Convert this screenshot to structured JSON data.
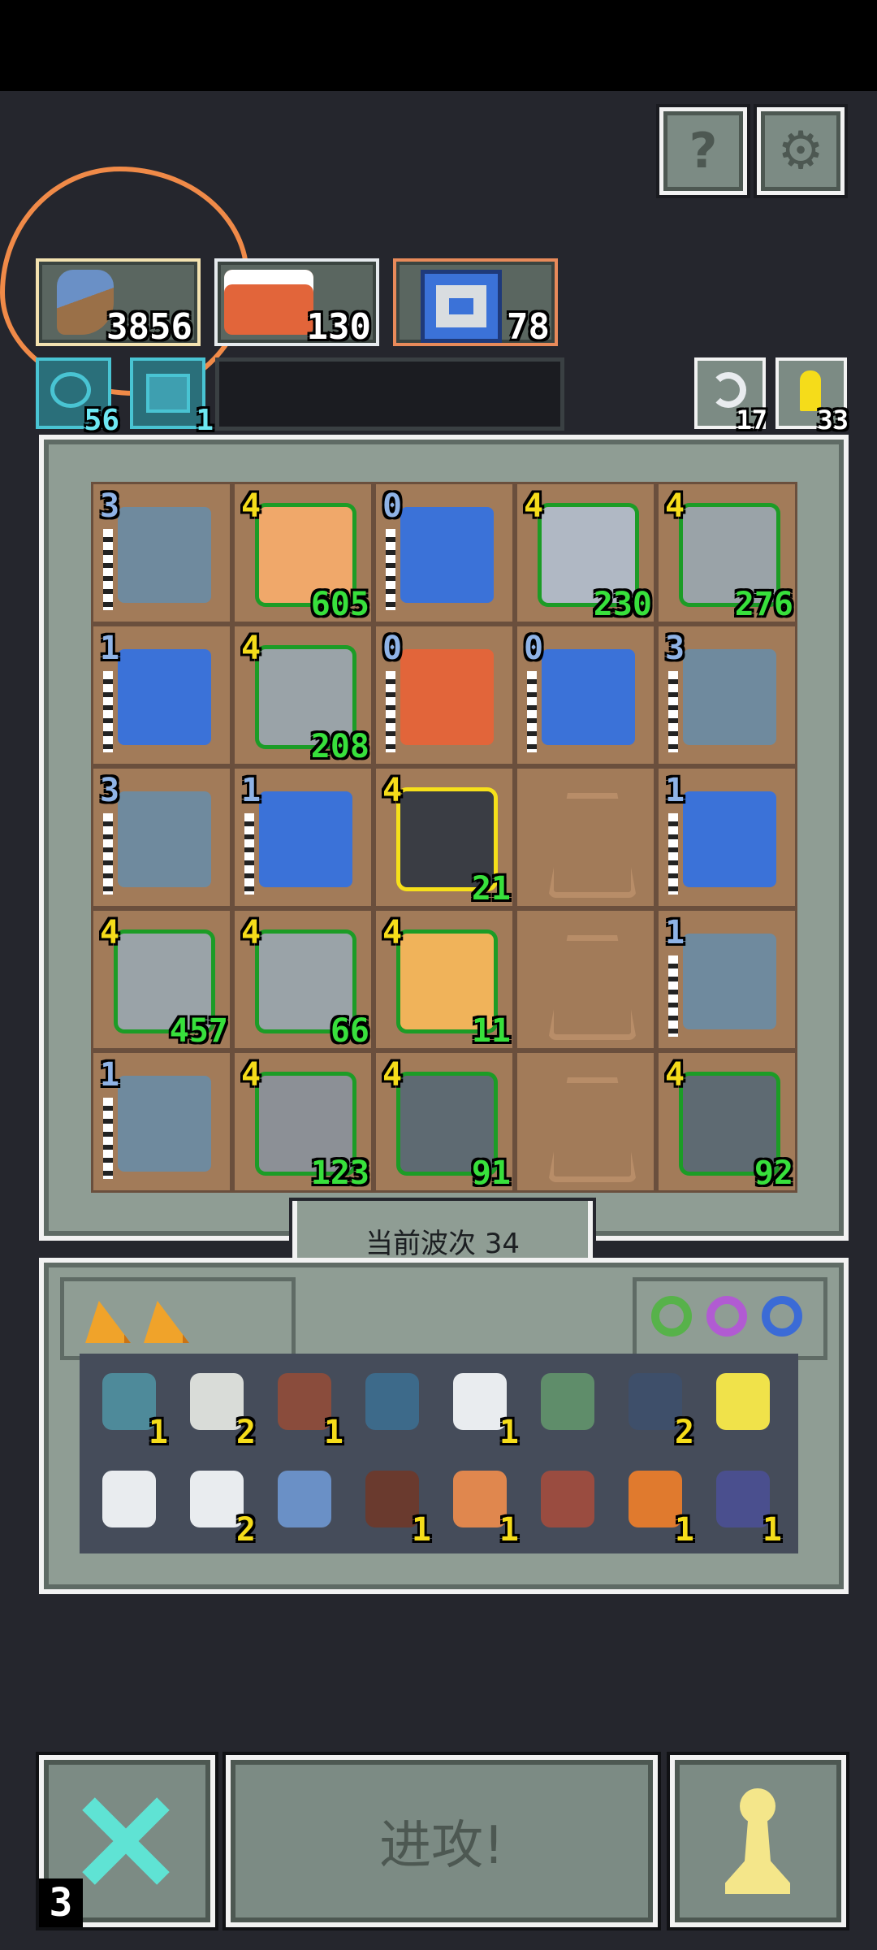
{
  "top_buttons": {
    "help_glyph": "?",
    "settings_glyph": "⚙"
  },
  "resources": [
    {
      "icon": "fish-item-icon",
      "value": "3856"
    },
    {
      "icon": "winged-demon-icon",
      "value": "130"
    },
    {
      "icon": "banner-tower-icon",
      "value": "78"
    }
  ],
  "chips": [
    {
      "icon": "eye-rune-icon",
      "value": "56"
    },
    {
      "icon": "tablet-icon",
      "value": "1"
    }
  ],
  "side_buttons": [
    {
      "icon": "undo-arrow-icon",
      "value": "17"
    },
    {
      "icon": "key-icon",
      "value": "33"
    }
  ],
  "board": {
    "cells": [
      {
        "type": "golem",
        "level": "3",
        "level_color": "blue",
        "count": ""
      },
      {
        "type": "gremlin",
        "level": "4",
        "level_color": "yellow",
        "count": "605",
        "frame": "green"
      },
      {
        "type": "banner",
        "level": "0",
        "level_color": "blue",
        "count": ""
      },
      {
        "type": "sorceress",
        "level": "4",
        "level_color": "yellow",
        "count": "230",
        "frame": "green"
      },
      {
        "type": "knight",
        "level": "4",
        "level_color": "yellow",
        "count": "276",
        "frame": "green"
      },
      {
        "type": "banner",
        "level": "1",
        "level_color": "blue",
        "count": ""
      },
      {
        "type": "knight",
        "level": "4",
        "level_color": "yellow",
        "count": "208",
        "frame": "green"
      },
      {
        "type": "demon",
        "level": "0",
        "level_color": "blue",
        "count": ""
      },
      {
        "type": "banner",
        "level": "0",
        "level_color": "blue",
        "count": ""
      },
      {
        "type": "golem",
        "level": "3",
        "level_color": "blue",
        "count": ""
      },
      {
        "type": "golem",
        "level": "3",
        "level_color": "blue",
        "count": ""
      },
      {
        "type": "banner",
        "level": "1",
        "level_color": "blue",
        "count": ""
      },
      {
        "type": "black-knight",
        "level": "4",
        "level_color": "yellow",
        "count": "21",
        "frame": "yellow"
      },
      {
        "type": "empty"
      },
      {
        "type": "banner",
        "level": "1",
        "level_color": "blue",
        "count": ""
      },
      {
        "type": "knight",
        "level": "4",
        "level_color": "yellow",
        "count": "457",
        "frame": "green"
      },
      {
        "type": "knight",
        "level": "4",
        "level_color": "yellow",
        "count": "66",
        "frame": "green"
      },
      {
        "type": "mummy",
        "level": "4",
        "level_color": "yellow",
        "count": "11",
        "frame": "green"
      },
      {
        "type": "empty"
      },
      {
        "type": "golem",
        "level": "1",
        "level_color": "blue",
        "count": ""
      },
      {
        "type": "golem",
        "level": "1",
        "level_color": "blue",
        "count": ""
      },
      {
        "type": "caped-knight",
        "level": "4",
        "level_color": "yellow",
        "count": "123",
        "frame": "green"
      },
      {
        "type": "shield-robot",
        "level": "4",
        "level_color": "yellow",
        "count": "91",
        "frame": "green"
      },
      {
        "type": "empty"
      },
      {
        "type": "shield-robot",
        "level": "4",
        "level_color": "yellow",
        "count": "92",
        "frame": "green"
      }
    ]
  },
  "wave_label": "当前波次 34",
  "inventory": {
    "rings": [
      {
        "icon": "green-ring-icon",
        "color": "#57b24a"
      },
      {
        "icon": "purple-ring-icon",
        "color": "#b15bd2"
      },
      {
        "icon": "blue-ring-icon",
        "color": "#3b6bd6"
      }
    ],
    "row1": [
      {
        "icon": "heart-gem-icon",
        "count": "1",
        "color": "#4e8a9a"
      },
      {
        "icon": "scroll-icon",
        "count": "2",
        "color": "#d9dcd8"
      },
      {
        "icon": "stacked-planks-icon",
        "count": "1",
        "color": "#8a4c3c"
      },
      {
        "icon": "blue-rock-icon",
        "count": "",
        "color": "#3d6a8a"
      },
      {
        "icon": "anvil-icon",
        "count": "1",
        "color": "#e9ecef"
      },
      {
        "icon": "portal-frame-icon",
        "count": "",
        "color": "#5f8d6a"
      },
      {
        "icon": "stone-wall-icon",
        "count": "2",
        "color": "#3e4f6a"
      },
      {
        "icon": "battle-axe-icon",
        "count": "",
        "color": "#f0e24a"
      }
    ],
    "row2": [
      {
        "icon": "wing-icon",
        "count": "",
        "color": "#e9ecef"
      },
      {
        "icon": "cloud-icon",
        "count": "2",
        "color": "#e9ecef"
      },
      {
        "icon": "fish-item-icon",
        "count": "",
        "color": "#6a90c6"
      },
      {
        "icon": "pickaxe-icon",
        "count": "1",
        "color": "#6a3a2e"
      },
      {
        "icon": "rope-icon",
        "count": "1",
        "color": "#e0874e"
      },
      {
        "icon": "volcano-icon",
        "count": "",
        "color": "#9a4c40"
      },
      {
        "icon": "horn-icon",
        "count": "1",
        "color": "#e07a2e"
      },
      {
        "icon": "pine-tree-icon",
        "count": "1",
        "color": "#4a4f8e"
      }
    ]
  },
  "bottom": {
    "cancel_badge": "3",
    "attack_label": "进攻!",
    "pawn_icon": "pawn-icon"
  },
  "colors": {
    "count_green": "#38e03c",
    "level_yellow": "#f5dc1a",
    "level_blue": "#8fb3e6"
  }
}
